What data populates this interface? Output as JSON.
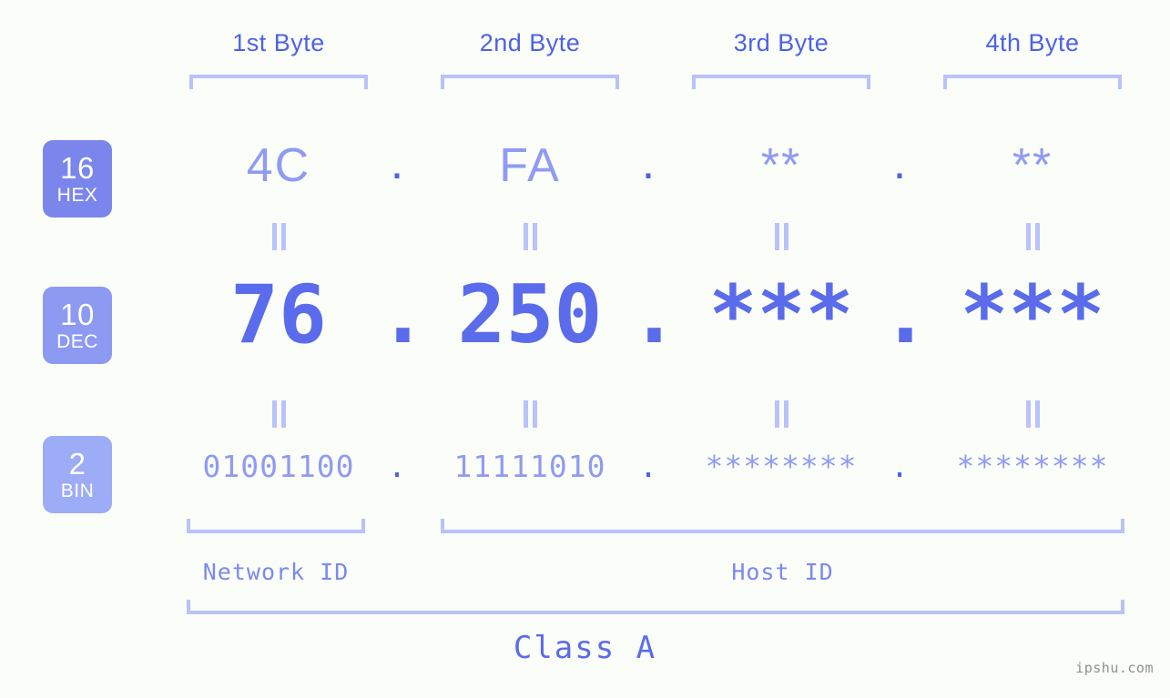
{
  "watermark": "ipshu.com",
  "byte_headers": [
    {
      "label": "1st Byte"
    },
    {
      "label": "2nd Byte"
    },
    {
      "label": "3rd Byte"
    },
    {
      "label": "4th Byte"
    }
  ],
  "radix_badges": [
    {
      "number": "16",
      "name": "HEX",
      "color": "#7b86ec"
    },
    {
      "number": "10",
      "name": "DEC",
      "color": "#8d9af1"
    },
    {
      "number": "2",
      "name": "BIN",
      "color": "#9dacf6"
    }
  ],
  "rows": {
    "hex": {
      "radix": "16",
      "radix_name": "HEX",
      "values": [
        "4C",
        "FA",
        "**",
        "**"
      ],
      "separator": "."
    },
    "dec": {
      "radix": "10",
      "radix_name": "DEC",
      "values": [
        "76",
        "250",
        "***",
        "***"
      ],
      "separator": "."
    },
    "bin": {
      "radix": "2",
      "radix_name": "BIN",
      "values": [
        "01001100",
        "11111010",
        "********",
        "********"
      ],
      "separator": "."
    }
  },
  "equivalence_symbol": "=",
  "segments": {
    "network_id": "Network ID",
    "host_id": "Host ID",
    "class": "Class A"
  },
  "colors": {
    "background": "#fbfdf8",
    "header_text": "#4e62e6",
    "bracket": "#b9c2fb",
    "value_light": "#8f9bf2",
    "value_strong": "#5a6ceb",
    "badge_hex": "#7b86ec",
    "badge_dec": "#8d9af1",
    "badge_bin": "#9dacf6",
    "watermark": "#8f8f8f"
  }
}
